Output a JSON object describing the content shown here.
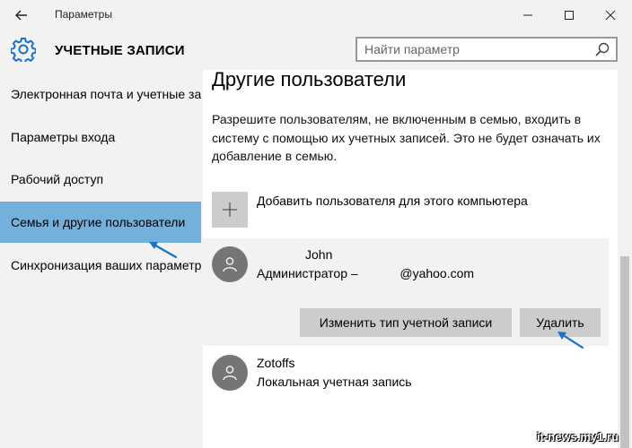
{
  "window": {
    "title": "Параметры",
    "controls": [
      "minimize",
      "maximize",
      "close"
    ]
  },
  "header": {
    "section_title": "УЧЕТНЫЕ ЗАПИСИ",
    "search_placeholder": "Найти параметр",
    "icon": "gear-icon"
  },
  "sidebar": {
    "items": [
      {
        "label": "Электронная почта и учетные записи",
        "selected": false
      },
      {
        "label": "Параметры входа",
        "selected": false
      },
      {
        "label": "Рабочий доступ",
        "selected": false
      },
      {
        "label": "Семья и другие пользователи",
        "selected": true
      },
      {
        "label": "Синхронизация ваших параметров",
        "selected": false
      }
    ]
  },
  "main": {
    "title": "Другие пользователи",
    "description": "Разрешите пользователям, не включенным в семью, входить в систему с помощью их учетных записей. Это не будет означать их добавление в семью.",
    "add_user_label": "Добавить пользователя для этого компьютера",
    "users": [
      {
        "name": "John",
        "detail": "Администратор –            @yahoo.com",
        "expanded": true
      },
      {
        "name": "Zotoffs",
        "detail": "Локальная учетная запись",
        "expanded": false
      }
    ],
    "buttons": {
      "change_type": "Изменить тип учетной записи",
      "delete": "Удалить"
    }
  },
  "watermark": "it-news.my1.ru",
  "colors": {
    "accent": "#1b72c0",
    "selected_bg": "#74b0dc",
    "panel_bg": "#f2f2f2",
    "button_bg": "#cccccc",
    "avatar_bg": "#757575"
  }
}
